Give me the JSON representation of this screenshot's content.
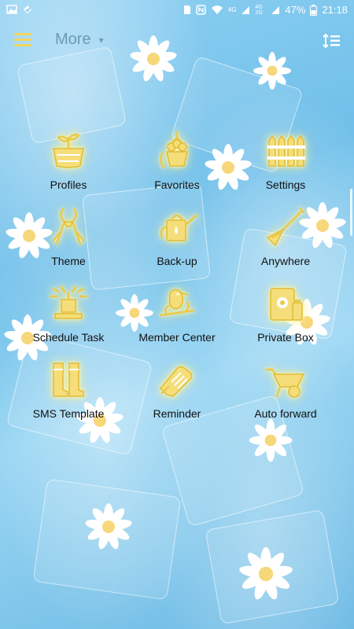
{
  "status_bar": {
    "network_4g": "4G",
    "network_4g_2g": "4G 2G",
    "battery": "47%",
    "time": "21:18"
  },
  "app_bar": {
    "title": "More",
    "caret": "▾"
  },
  "items": [
    {
      "label": "Profiles",
      "icon": "flower-basket-icon"
    },
    {
      "label": "Favorites",
      "icon": "hanging-flowerpot-icon"
    },
    {
      "label": "Settings",
      "icon": "fence-icon"
    },
    {
      "label": "Theme",
      "icon": "pruning-shears-icon"
    },
    {
      "label": "Back-up",
      "icon": "watering-can-icon"
    },
    {
      "label": "Anywhere",
      "icon": "shovel-icon"
    },
    {
      "label": "Schedule Task",
      "icon": "sprinkler-icon"
    },
    {
      "label": "Member Center",
      "icon": "bird-on-branch-icon"
    },
    {
      "label": "Private Box",
      "icon": "seed-bag-icon"
    },
    {
      "label": "SMS Template",
      "icon": "garden-boots-icon"
    },
    {
      "label": "Reminder",
      "icon": "gardening-gloves-icon"
    },
    {
      "label": "Auto forward",
      "icon": "wheelbarrow-icon"
    }
  ]
}
